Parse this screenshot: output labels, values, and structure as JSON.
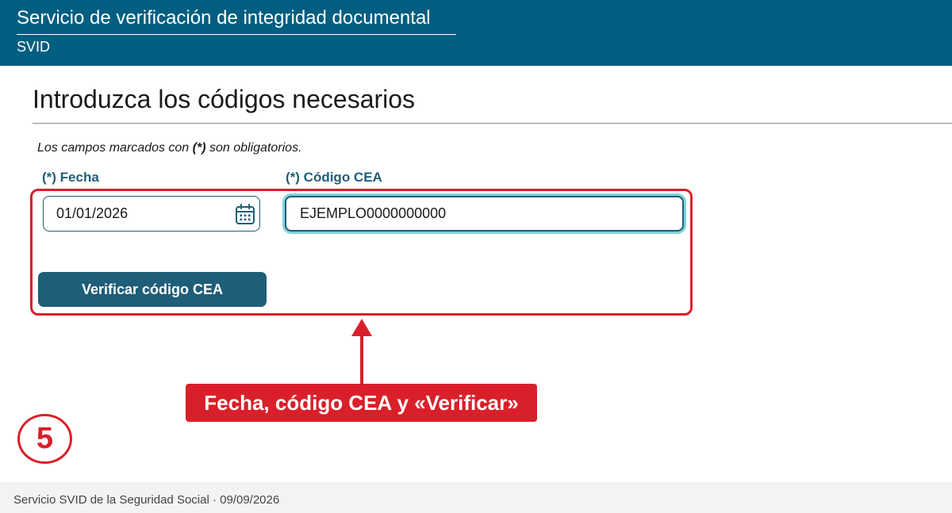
{
  "header": {
    "title": "Servicio de verificación de integridad documental",
    "subtitle": "SVID"
  },
  "page": {
    "title": "Introduzca los códigos necesarios",
    "required_note_prefix": "Los campos marcados con ",
    "required_note_marker": "(*)",
    "required_note_suffix": " son obligatorios."
  },
  "form": {
    "fecha": {
      "label": "(*) Fecha",
      "value": "01/01/2026"
    },
    "cea": {
      "label": "(*) Código CEA",
      "value": "EJEMPLO0000000000"
    },
    "submit_label": "Verificar código CEA"
  },
  "annotation": {
    "callout": "Fecha, código CEA y «Verificar»",
    "step": "5",
    "color": "#d9202a"
  },
  "footer": {
    "text": "Servicio SVID de la Seguridad Social · 09/09/2026"
  },
  "icons": {
    "calendar": "calendar-icon",
    "arrow": "arrow-up-icon"
  },
  "colors": {
    "header_bg": "#015e80",
    "primary": "#1f5e78",
    "focus_ring": "#7fd3dc",
    "annotation": "#d9202a"
  }
}
